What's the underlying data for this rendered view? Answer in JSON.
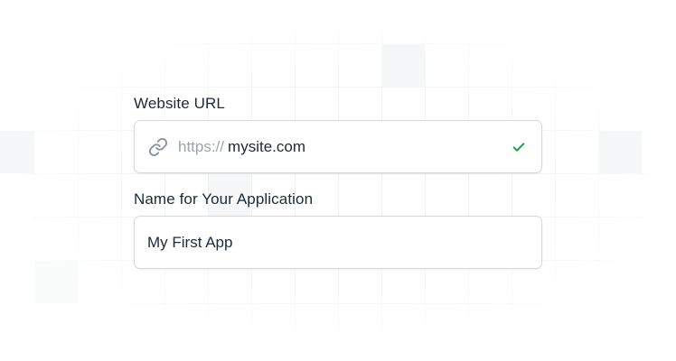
{
  "url_field": {
    "label": "Website URL",
    "prefix": "https://",
    "value": "mysite.com",
    "icon": "link-icon",
    "status_icon": "check-icon",
    "status_color": "#16a34a"
  },
  "app_name_field": {
    "label": "Name for Your Application",
    "value": "My First App"
  }
}
